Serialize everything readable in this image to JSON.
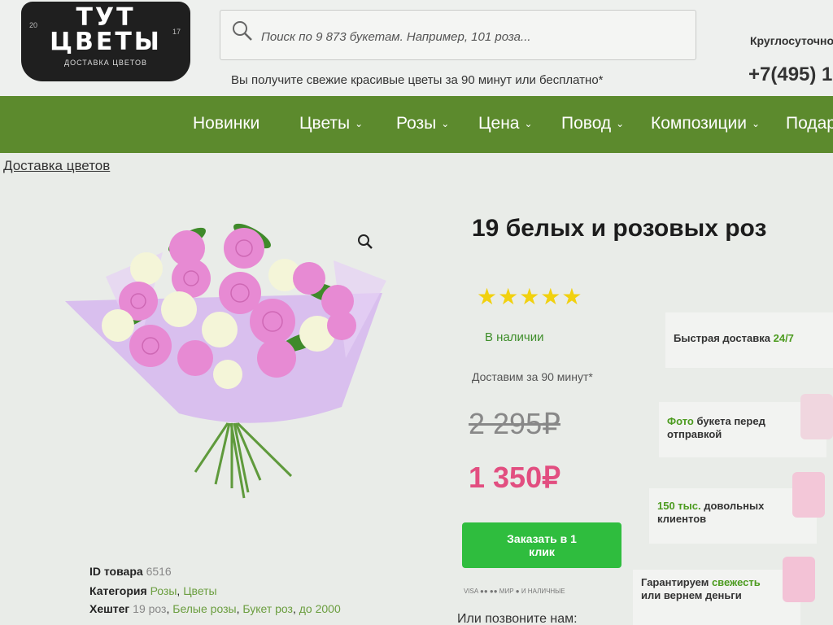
{
  "header": {
    "logo": {
      "line1": "ТУТ",
      "line2": "ЦВЕТЫ",
      "subtitle": "ДОСТАВКА ЦВЕТОВ",
      "num_left": "20",
      "num_right": "17"
    },
    "search_placeholder": "Поиск по 9 873 букетам. Например, 101 роза...",
    "tagline": "Вы получите свежие красивые цветы за 90 минут или бесплатно*",
    "hours": "Круглосуточно",
    "phone": "+7(495) 1"
  },
  "nav": {
    "items": [
      {
        "label": "Новинки",
        "dropdown": false
      },
      {
        "label": "Цветы",
        "dropdown": true
      },
      {
        "label": "Розы",
        "dropdown": true
      },
      {
        "label": "Цена",
        "dropdown": true
      },
      {
        "label": "Повод",
        "dropdown": true
      },
      {
        "label": "Композиции",
        "dropdown": true
      },
      {
        "label": "Подар",
        "dropdown": false
      }
    ]
  },
  "breadcrumb": "Доставка цветов",
  "product": {
    "title": "19 белых и розовых роз",
    "rating_stars": "★★★★★",
    "rating": 5,
    "stock": "В наличии",
    "delivery_time": "Доставим за 90 минут*",
    "old_price": "2 295₽",
    "new_price": "1 350₽",
    "order_button": {
      "line1": "Заказать в 1",
      "line2": "клик"
    },
    "payments": "VISA  ●●  ●●  МИР  ●  И НАЛИЧНЫЕ",
    "call_label": "Или позвоните нам:"
  },
  "advantages": {
    "fast_delivery": {
      "text": "Быстрая доставка ",
      "highlight": "24/7"
    },
    "photo": {
      "highlight": "Фото",
      "text1": " букета перед",
      "text2": "отправкой"
    },
    "clients": {
      "highlight": "150 тыс.",
      "text1": " довольных",
      "text2": "клиентов"
    },
    "guarantee": {
      "text1": "Гарантируем ",
      "highlight": "свежесть",
      "text2": "или вернем деньги"
    }
  },
  "meta": {
    "id_label": "ID товара",
    "id_value": "6516",
    "category_label": "Категория",
    "categories": [
      "Розы",
      "Цветы"
    ],
    "hashtag_label": "Хештег",
    "hashtag_plain": "19 роз",
    "hashtags": [
      "Белые розы",
      "Букет роз",
      "до 2000"
    ]
  },
  "colors": {
    "nav_bg": "#5c8a2d",
    "order_button": "#2fbd3e",
    "new_price": "#e24e80",
    "stars": "#f1d10f",
    "accent_green": "#4c9b1f"
  }
}
